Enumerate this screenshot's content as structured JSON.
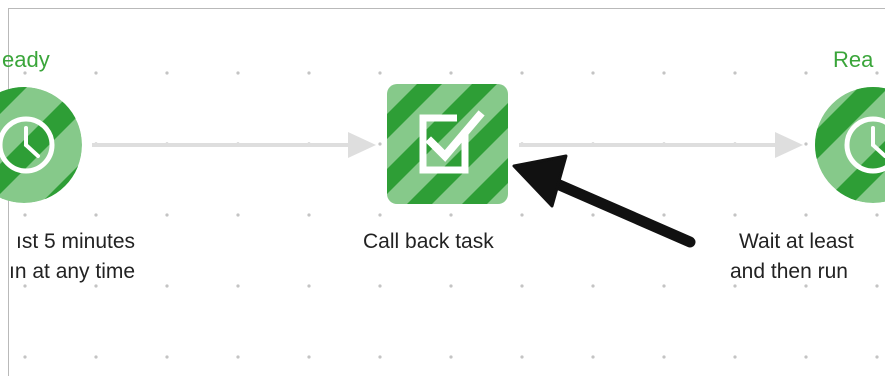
{
  "workflow": {
    "left_node": {
      "status": "eady",
      "line1": "ıst 5 minutes",
      "line2": "ın at any time",
      "icon": "clock-icon"
    },
    "center_node": {
      "label": "Call back task",
      "icon": "checkbox-checked-icon"
    },
    "right_node": {
      "status": "Rea",
      "line1": "Wait at least",
      "line2": "and then run",
      "icon": "clock-icon"
    }
  },
  "colors": {
    "node_green_dark": "#2e9e36",
    "node_green_light": "#86c98a",
    "status_green": "#3aa53a",
    "connector_gray": "#dedede",
    "pointer_arrow": "#111111"
  }
}
